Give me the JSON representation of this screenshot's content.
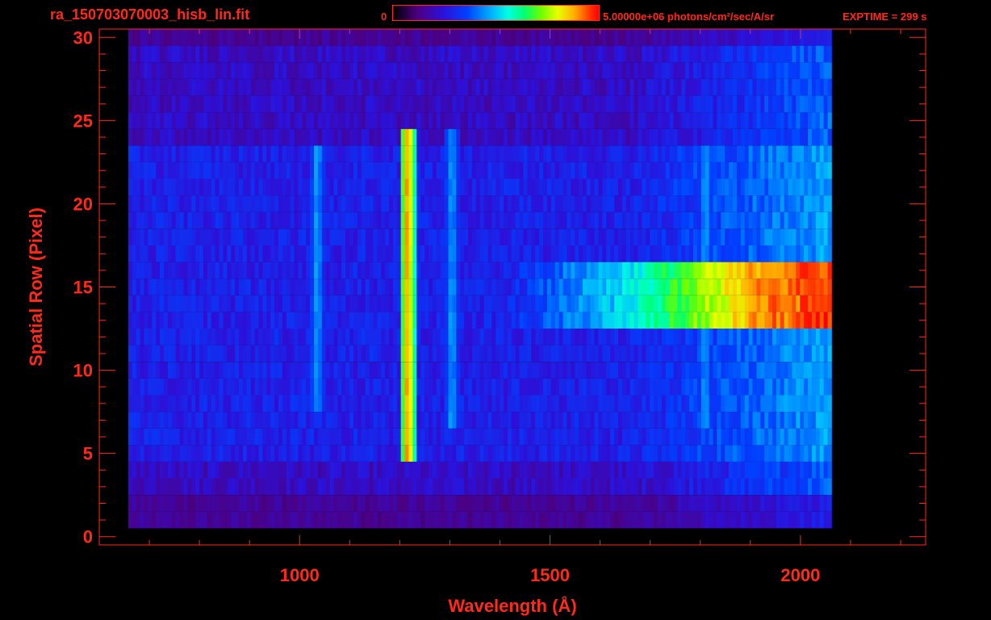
{
  "header": {
    "file_title": "ra_150703070003_hisb_lin.fit",
    "colorbar_min": "0",
    "colorbar_max": "5.00000e+06 photons/cm²/sec/A/sr",
    "exptime": "EXPTIME = 299 s"
  },
  "colors": {
    "axis": "#ff2a1a",
    "background": "#000000"
  },
  "chart_data": {
    "type": "heatmap",
    "title": "ra_150703070003_hisb_lin.fit",
    "xlabel": "Wavelength (Å)",
    "ylabel": "Spatial Row (Pixel)",
    "xlim": [
      600,
      2250
    ],
    "ylim": [
      -0.5,
      30.5
    ],
    "x_ticks": [
      1000,
      1500,
      2000
    ],
    "y_ticks": [
      0,
      5,
      10,
      15,
      20,
      25,
      30
    ],
    "colorscale": "rainbow",
    "color_range": [
      0,
      5000000
    ],
    "color_units": "photons/cm²/sec/A/sr",
    "exposure_time_s": 299,
    "features": [
      {
        "name": "bright line",
        "wavelength": 1216,
        "rows": [
          5,
          24
        ],
        "peak_level": 0.95
      },
      {
        "name": "emission line",
        "wavelength": 1304,
        "rows": [
          7,
          24
        ],
        "peak_level": 0.5
      },
      {
        "name": "emission line",
        "wavelength": 1035,
        "rows": [
          8,
          23
        ],
        "peak_level": 0.5
      },
      {
        "name": "emission band",
        "wavelength": 1810,
        "rows": [
          7,
          23
        ],
        "peak_level": 0.5
      },
      {
        "name": "continuum",
        "wavelength_range": [
          1450,
          2060
        ],
        "rows": [
          13,
          16
        ],
        "peak_level": 0.9
      }
    ]
  }
}
